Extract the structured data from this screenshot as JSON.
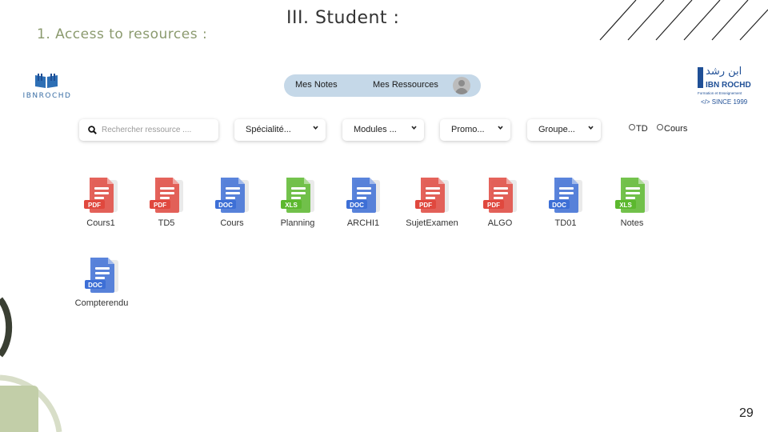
{
  "slide": {
    "title": "III. Student :",
    "section": "1. Access to resources :",
    "page_number": "29"
  },
  "logos": {
    "left_text": "IBNROCHD",
    "right_arabic": "ابن رشد",
    "right_name": "IBN ROCHD",
    "right_subtitle": "Formation et Enseignement",
    "right_since": "</> SINCE 1999"
  },
  "nav": {
    "notes": "Mes Notes",
    "resources": "Mes Ressources"
  },
  "filters": {
    "search_placeholder": "Rechercher ressource ....",
    "specialite": "Spécialité...",
    "modules": "Modules ...",
    "promo": "Promo...",
    "groupe": "Groupe...",
    "radio_td": "TD",
    "radio_cours": "Cours"
  },
  "files": [
    {
      "name": "Cours1",
      "type": "PDF"
    },
    {
      "name": "TD5",
      "type": "PDF"
    },
    {
      "name": "Cours",
      "type": "DOC"
    },
    {
      "name": "Planning",
      "type": "XLS"
    },
    {
      "name": "ARCHI1",
      "type": "DOC"
    },
    {
      "name": "SujetExamen",
      "type": "PDF"
    },
    {
      "name": "ALGO",
      "type": "PDF"
    },
    {
      "name": "TD01",
      "type": "DOC"
    },
    {
      "name": "Notes",
      "type": "XLS"
    },
    {
      "name": "Compterendu",
      "type": "DOC"
    }
  ],
  "colors": {
    "pdf": "#e0483e",
    "doc": "#3d6fd6",
    "xls": "#5cb82e",
    "accent_green": "#8b9a6e",
    "nav_bg": "#c5d8e8",
    "logo_blue": "#1f4f96"
  }
}
